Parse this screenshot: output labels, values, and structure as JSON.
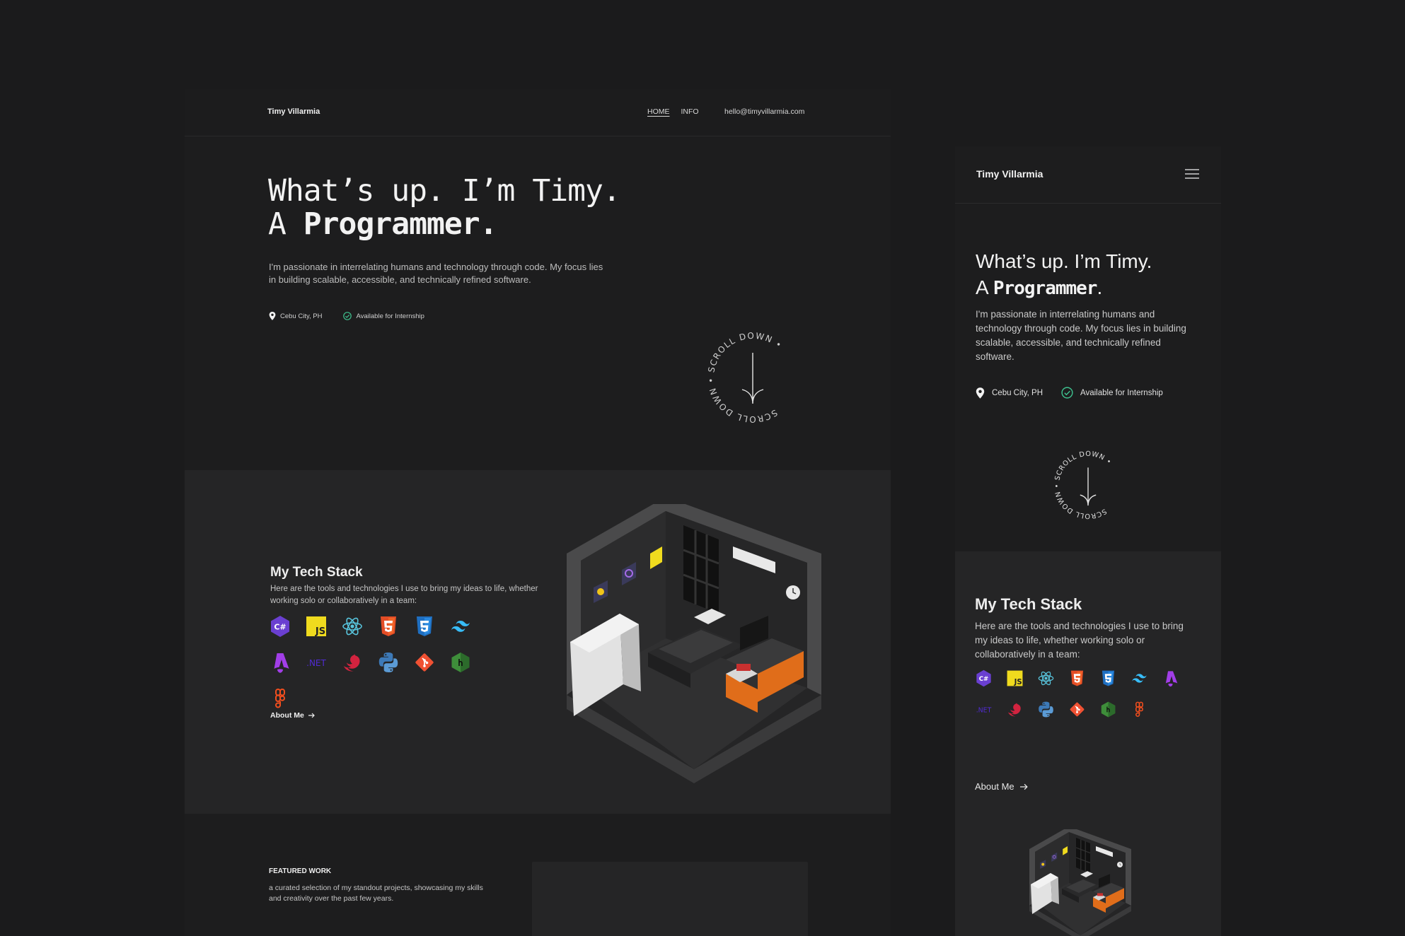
{
  "desktop": {
    "brand": "Timy Villarmia",
    "nav": [
      {
        "label": "HOME",
        "active": true
      },
      {
        "label": "INFO",
        "active": false
      }
    ],
    "email": "hello@timyvillarmia.com",
    "hero": {
      "title_line1": "What’s up. I’m Timy.",
      "title_line2_prefix": "A ",
      "title_line2_emphasis": "Programmer",
      "title_line2_suffix": ".",
      "description": "I'm passionate in interrelating humans and technology through code. My focus lies in building scalable, accessible, and technically refined software.",
      "location": "Cebu City, PH",
      "availability": "Available for Internship",
      "scroll_text": "SCROLL DOWN • SCROLL DOWN •"
    },
    "tech_stack": {
      "title": "My Tech Stack",
      "description": "Here are the tools and technologies I use to bring my ideas to life, whether working solo or collaboratively in a team:",
      "about_link": "About Me"
    },
    "featured": {
      "title": "FEATURED WORK",
      "description": "a curated selection of my standout projects, showcasing my skills and creativity over the past few years."
    }
  },
  "mobile": {
    "brand": "Timy Villarmia",
    "hero": {
      "title_line1": "What’s up. I’m Timy.",
      "title_line2_prefix": "A ",
      "title_line2_emphasis": "Programmer",
      "title_line2_suffix": ".",
      "description": "I'm passionate in interrelating humans and technology through code. My focus lies in building scalable, accessible, and technically refined software.",
      "location": "Cebu City, PH",
      "availability": "Available for Internship",
      "scroll_text": "SCROLL DOWN • SCROLL DOWN •"
    },
    "tech_stack": {
      "title": "My Tech Stack",
      "description": "Here are the tools and technologies I use to bring my ideas to life, whether working solo or collaboratively in a team:",
      "about_link": "About Me"
    }
  },
  "tech_icons": [
    {
      "name": "csharp-icon",
      "color": "#6a3fd1"
    },
    {
      "name": "javascript-icon",
      "color": "#f0db1e"
    },
    {
      "name": "react-icon",
      "color": "#58c4dc"
    },
    {
      "name": "html5-icon",
      "color": "#e44d26"
    },
    {
      "name": "css3-icon",
      "color": "#1f6fc1"
    },
    {
      "name": "tailwind-icon",
      "color": "#38bdf8"
    },
    {
      "name": "astro-icon",
      "color": "#a23ee8"
    },
    {
      "name": "dotnet-icon",
      "color": "#512bd4",
      "text": ".NET"
    },
    {
      "name": "nestjs-icon",
      "color": "#d3233f"
    },
    {
      "name": "python-icon",
      "color": "#3d7ab8"
    },
    {
      "name": "git-icon",
      "color": "#f05133"
    },
    {
      "name": "nodejs-icon",
      "color": "#3e8e3a"
    },
    {
      "name": "figma-icon",
      "color": "#f24e1e"
    }
  ],
  "colors": {
    "background": "#1b1b1c",
    "panel": "#1d1d1e",
    "section_alt": "#252526",
    "accent_green": "#3ec28f",
    "room_accent": "#e06d1a"
  }
}
